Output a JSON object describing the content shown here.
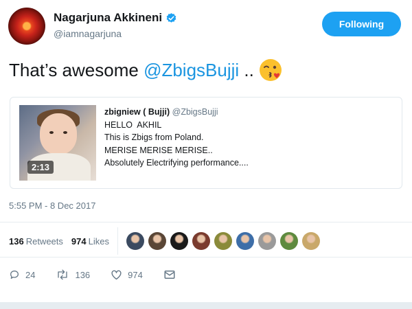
{
  "author": {
    "display_name": "Nagarjuna Akkineni",
    "handle": "@iamnagarjuna",
    "verified": true
  },
  "follow_button": {
    "label": "Following",
    "color": "#1da1f2"
  },
  "tweet": {
    "text_prefix": "That’s awesome ",
    "mention": "@ZbigsBujji",
    "text_suffix": " ..",
    "emoji": "kissing-face-winking-emoji"
  },
  "quoted_tweet": {
    "name": "zbigniew ( Bujji)",
    "handle": "@ZbigsBujji",
    "lines": [
      "HELLO  AKHIL",
      "This is Zbigs from Poland.",
      "MERISE MERISE MERISE..",
      "Absolutely Electrifying performance...."
    ],
    "video_duration": "2:13"
  },
  "timestamp": "5:55 PM - 8 Dec 2017",
  "stats": {
    "retweets_count": "136",
    "retweets_label": "Retweets",
    "likes_count": "974",
    "likes_label": "Likes"
  },
  "likers": [
    {
      "icon": "liker-avatar-1",
      "color": "#3b4a60"
    },
    {
      "icon": "liker-avatar-2",
      "color": "#5a4636"
    },
    {
      "icon": "liker-avatar-3",
      "color": "#1a1a1a"
    },
    {
      "icon": "liker-avatar-4",
      "color": "#7a3b2e"
    },
    {
      "icon": "liker-avatar-5",
      "color": "#8a8a3a"
    },
    {
      "icon": "liker-avatar-6",
      "color": "#3d6ea8"
    },
    {
      "icon": "liker-avatar-7",
      "color": "#9a9a9a"
    },
    {
      "icon": "liker-avatar-8",
      "color": "#5e8a3e"
    },
    {
      "icon": "liker-avatar-9",
      "color": "#c9a86a"
    }
  ],
  "actions": {
    "reply_count": "24",
    "retweet_count": "136",
    "like_count": "974"
  },
  "colors": {
    "accent": "#1da1f2",
    "mention": "#1b95e0",
    "muted": "#657786"
  }
}
